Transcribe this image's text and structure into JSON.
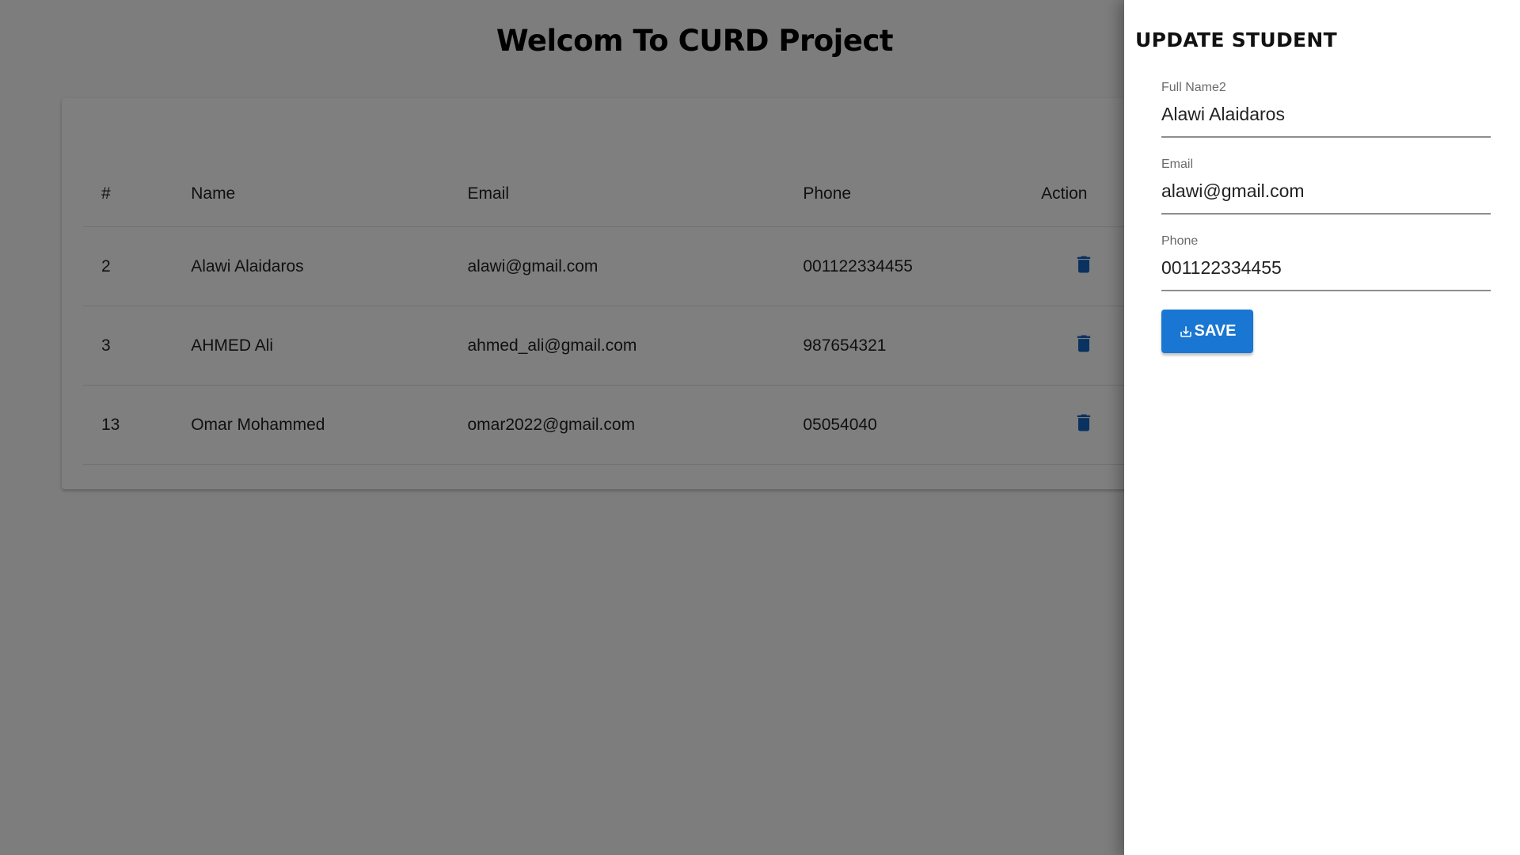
{
  "app": {
    "title": "Welcom To CURD Project"
  },
  "table": {
    "headers": {
      "id": "#",
      "name": "Name",
      "email": "Email",
      "phone": "Phone",
      "action": "Action"
    },
    "rows": [
      {
        "id": "2",
        "name": "Alawi Alaidaros",
        "email": "alawi@gmail.com",
        "phone": "001122334455",
        "action_icon": "delete-icon"
      },
      {
        "id": "3",
        "name": "AHMED Ali",
        "email": "ahmed_ali@gmail.com",
        "phone": "987654321",
        "action_icon": "delete-icon"
      },
      {
        "id": "13",
        "name": "Omar Mohammed",
        "email": "omar2022@gmail.com",
        "phone": "05054040",
        "action_icon": "delete-icon"
      }
    ]
  },
  "drawer": {
    "title": "UPDATE STUDENT",
    "fields": {
      "full_name": {
        "label": "Full Name2",
        "value": "Alawi Alaidaros"
      },
      "email": {
        "label": "Email",
        "value": "alawi@gmail.com"
      },
      "phone": {
        "label": "Phone",
        "value": "001122334455"
      }
    },
    "save_label": "SAVE",
    "save_icon": "download-icon"
  },
  "colors": {
    "primary": "#1976d2",
    "delete_icon": "#1565c0",
    "overlay": "rgba(0,0,0,0.5)"
  }
}
